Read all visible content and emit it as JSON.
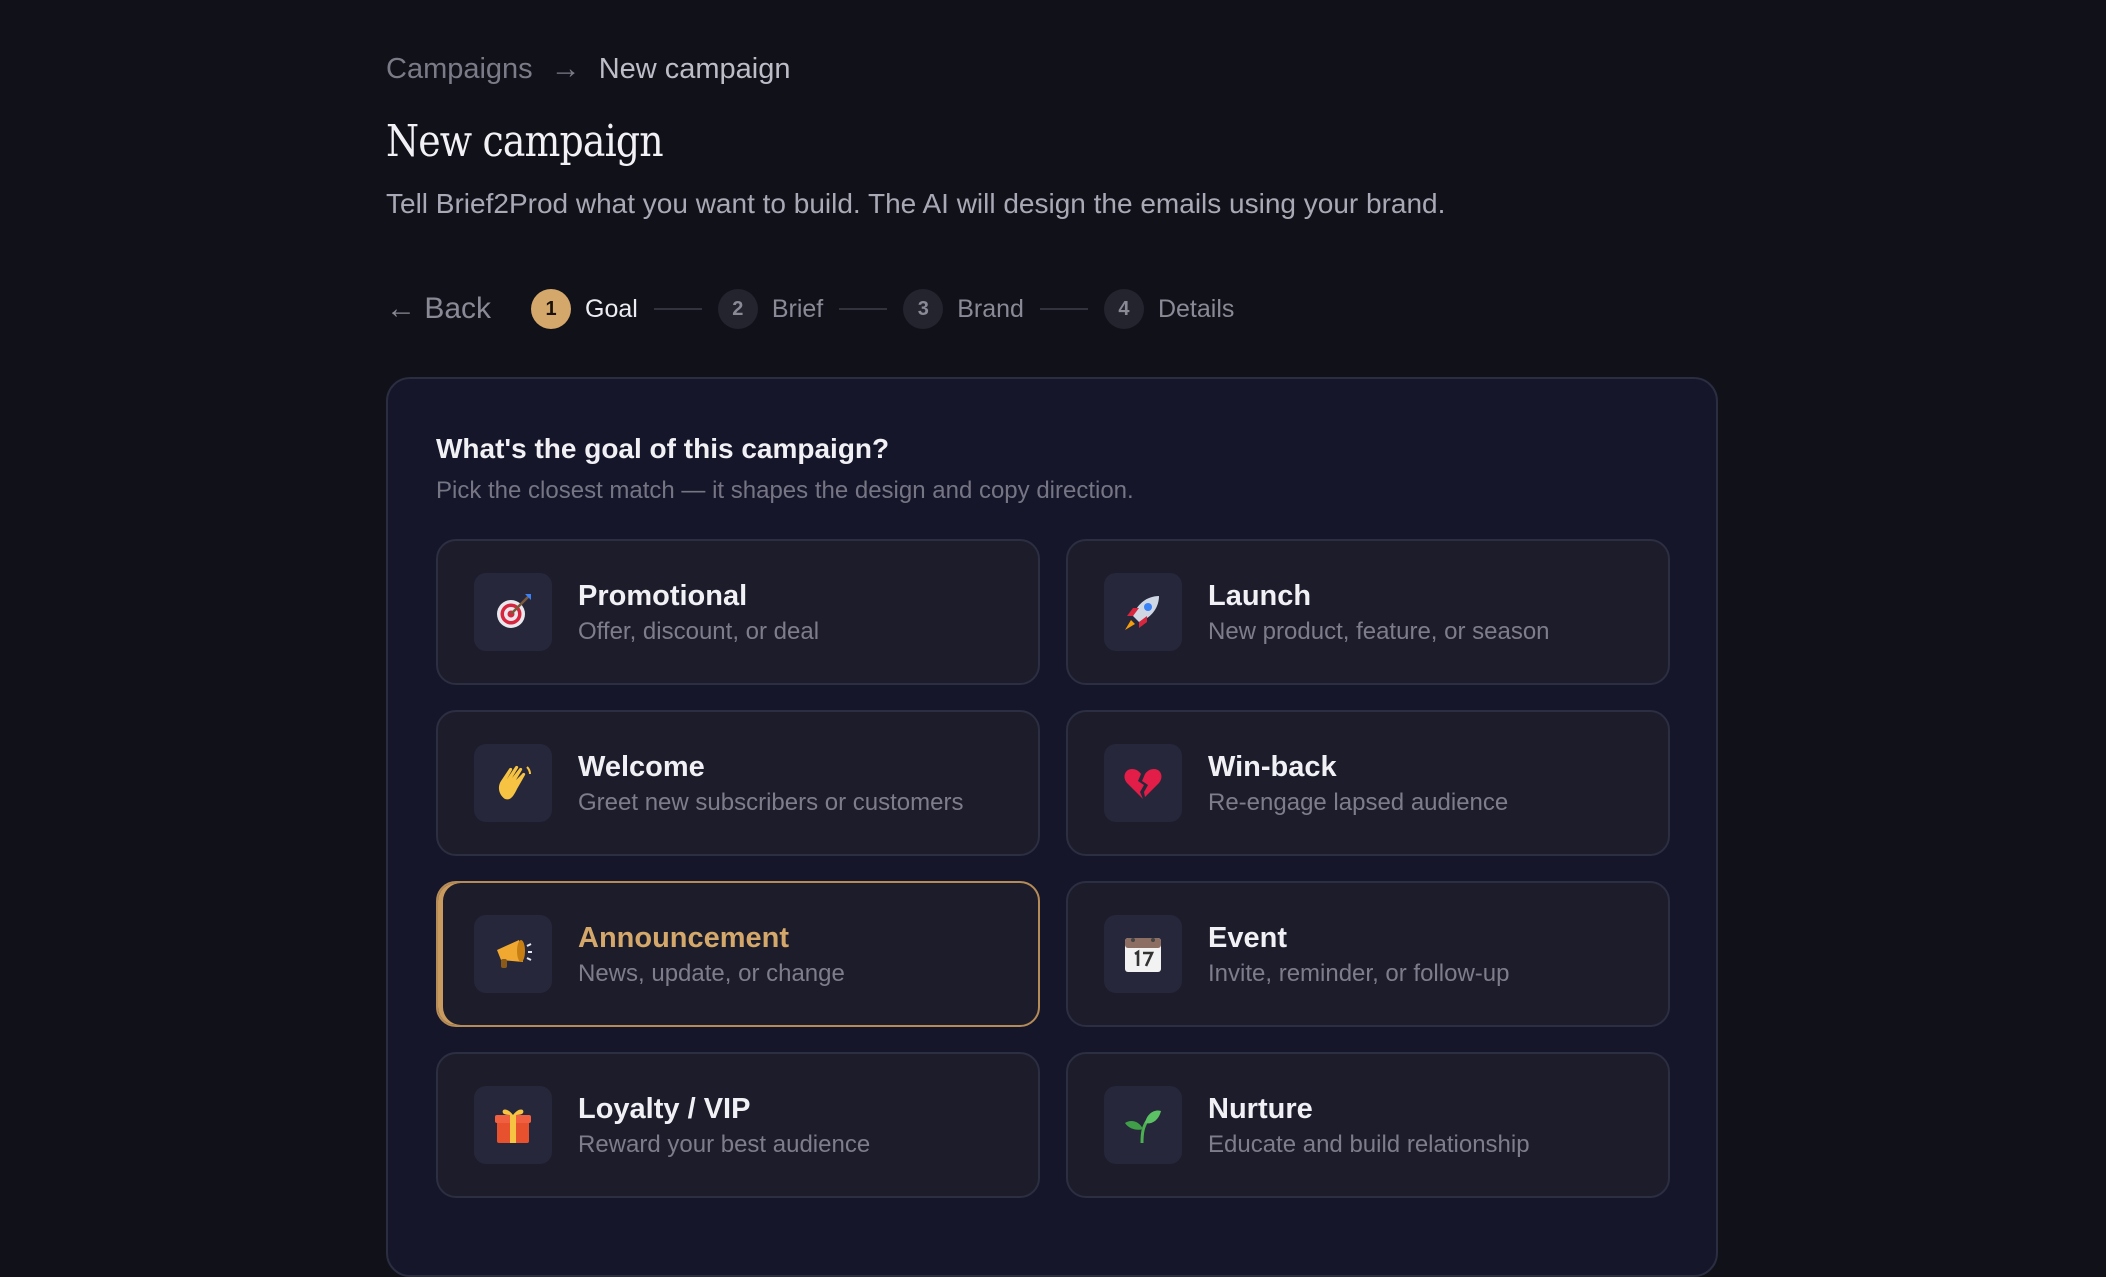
{
  "breadcrumb": {
    "parent": "Campaigns",
    "separator": "→",
    "current": "New campaign"
  },
  "header": {
    "title": "New campaign",
    "subtitle": "Tell Brief2Prod what you want to build. The AI will design the emails using your brand."
  },
  "stepper": {
    "back_label": "← Back",
    "active_step": 1,
    "steps": [
      {
        "number": "1",
        "label": "Goal"
      },
      {
        "number": "2",
        "label": "Brief"
      },
      {
        "number": "3",
        "label": "Brand"
      },
      {
        "number": "4",
        "label": "Details"
      }
    ]
  },
  "goal_card": {
    "title": "What's the goal of this campaign?",
    "description": "Pick the closest match — it shapes the design and copy direction.",
    "selected": "Announcement",
    "options": [
      {
        "title": "Promotional",
        "description": "Offer, discount, or deal",
        "icon": "target-icon"
      },
      {
        "title": "Launch",
        "description": "New product, feature, or season",
        "icon": "rocket-icon"
      },
      {
        "title": "Welcome",
        "description": "Greet new subscribers or customers",
        "icon": "waving-hand-icon"
      },
      {
        "title": "Win-back",
        "description": "Re-engage lapsed audience",
        "icon": "broken-heart-icon"
      },
      {
        "title": "Announcement",
        "description": "News, update, or change",
        "icon": "megaphone-icon"
      },
      {
        "title": "Event",
        "description": "Invite, reminder, or follow-up",
        "icon": "calendar-icon"
      },
      {
        "title": "Loyalty / VIP",
        "description": "Reward your best audience",
        "icon": "gift-icon"
      },
      {
        "title": "Nurture",
        "description": "Educate and build relationship",
        "icon": "seedling-icon"
      }
    ]
  },
  "colors": {
    "background": "#111119",
    "card_background": "#151629",
    "accent": "#d4a76a"
  }
}
